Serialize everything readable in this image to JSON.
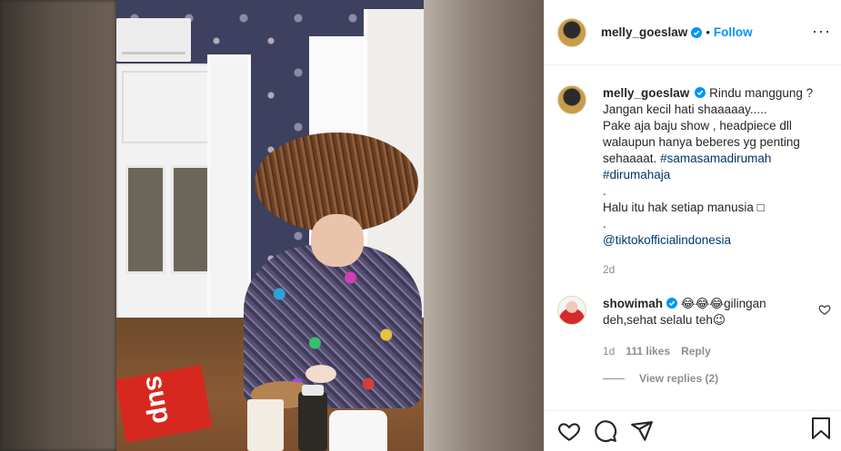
{
  "post": {
    "author": {
      "username": "melly_goeslaw",
      "verified": true,
      "follow_label": "Follow",
      "dot": "•"
    },
    "more_label": "···",
    "media": {
      "book_text": "sup"
    },
    "caption": {
      "username": "melly_goeslaw",
      "lines": [
        "Rindu manggung ?",
        "Jangan kecil hati shaaaaay.....",
        "Pake aja baju show , headpiece dll",
        "walaupun hanya beberes yg penting",
        "sehaaaat."
      ],
      "hashtag_1": "#samasamadirumah",
      "hashtag_2": "#dirumahaja",
      "dot_line_1": ".",
      "halu_line": "Halu itu hak setiap manusia ",
      "halu_emoji": "□",
      "dot_line_2": ".",
      "mention": "@tiktokofficialindonesia",
      "time": "2d"
    },
    "comment": {
      "username": "showimah",
      "verified": true,
      "text_emoji": "😂😂😂",
      "text_1": "gilingan",
      "text_2": "deh,sehat selalu teh",
      "text_emoji_2": "😉",
      "time": "1d",
      "likes": "111 likes",
      "reply_label": "Reply",
      "view_replies": "View replies (2)"
    },
    "icons": {
      "like": "heart-icon",
      "comment": "comment-icon",
      "share": "share-icon",
      "save": "bookmark-icon"
    },
    "colors": {
      "link_blue": "#0095f6",
      "hashtag": "#00376b",
      "meta_gray": "#8e8e8e"
    }
  }
}
